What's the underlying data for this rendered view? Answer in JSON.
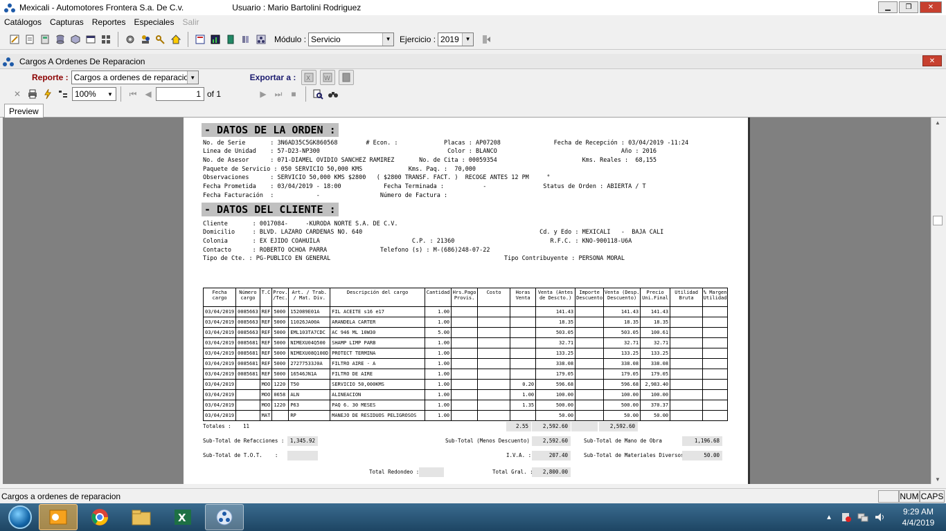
{
  "window": {
    "title": "Mexicali - Automotores Frontera S.a. De  C.v.",
    "user": "Usuario : Mario Bartolini Rodriguez"
  },
  "menu": [
    "Catálogos",
    "Capturas",
    "Reportes",
    "Especiales"
  ],
  "menu_disabled": "Salir",
  "toolbar": {
    "modulo_label": "Módulo :",
    "modulo_value": "Servicio",
    "ejercicio_label": "Ejercicio :",
    "ejercicio_value": "2019"
  },
  "child": {
    "title": "Cargos A Ordenes De Reparacion"
  },
  "report": {
    "label": "Reporte :",
    "value": "Cargos a ordenes de reparacion",
    "export_label": "Exportar a :"
  },
  "viewer": {
    "zoom": "100%",
    "page": "1",
    "of": "of 1",
    "tab": "Preview"
  },
  "doc": {
    "sec1": "- DATOS DE LA ORDEN :",
    "orden": [
      "No. de Serie       : 3N6AD35C5GK860568        # Econ. :             Placas : AP07208               Fecha de Recepción : 03/04/2019 -11:24",
      "Linea de Unidad    : 57-D23-NP300                                    Color : BLANCO                                   Año : 2016",
      "No. de Asesor      : 071-DIAMEL OVIDIO SANCHEZ RAMIREZ       No. de Cita : 00059354                        Kms. Reales :  68,155",
      "Paquete de Servicio : 050 SERVICIO 50,000 KMS             Kms. Paq. :  70,000",
      "Observaciones      : SERVICIO 50,000 KMS $2800   ( $2800 TRANSF. FACT. )  RECOGE ANTES 12 PM     °",
      "Fecha Prometida    : 03/04/2019 - 18:00            Fecha Terminada :           -                Status de Orden : ABIERTA / T",
      "Fecha Facturación  :            -                 Número de Factura :"
    ],
    "sec2": "- DATOS DEL CLIENTE :",
    "cliente": [
      "Cliente       : 0017084-     -KURODA NORTE S.A. DE C.V.",
      "Domicilio     : BLVD. LAZARO CARDENAS NO. 640                                                  Cd. y Edo : MEXICALI   -  BAJA CALI",
      "Colonia       : EX EJIDO COAHUILA                          C.P. : 21360                           R.F.C. : KNO-900118-U6A",
      "Contacto      : ROBERTO OCHOA PARRA               Telefono (s) : M-(686)248-07-22",
      "Tipo de Cte. : PG-PUBLICO EN GENERAL                                                 Tipo Contribuyente : PERSONA MORAL"
    ],
    "columns": [
      "Fecha cargo",
      "Número cargo",
      "T.C",
      "Prov. /Tec.",
      "Art. / Trab. / Mat. Div.",
      "Descripción del cargo",
      "Cantidad",
      "Hrs.Pago Provis.",
      "Costo",
      "Horas Venta",
      "Venta (Antes de Descto.)",
      "Importe Descuento",
      "Venta (Desp. Descuento)",
      "Precio Uni.Final",
      "Utilidad Bruta",
      "% Margen Utilidad"
    ],
    "rows": [
      [
        "03/04/2019",
        "0085663",
        "REF",
        "5000",
        "152089E01A",
        "FIL  ACEITE s16 e17",
        "1.00",
        "",
        "",
        "",
        "141.43",
        "",
        "141.43",
        "141.43",
        "",
        ""
      ],
      [
        "03/04/2019",
        "0085663",
        "REF",
        "5000",
        "11026JA00A",
        "ARANDELA CARTER",
        "1.00",
        "",
        "",
        "",
        "18.35",
        "",
        "18.35",
        "18.35",
        "",
        ""
      ],
      [
        "03/04/2019",
        "0085663",
        "REF",
        "5000",
        "EML103TA7CDC",
        "AC 946 ML 10W30",
        "5.00",
        "",
        "",
        "",
        "503.05",
        "",
        "503.05",
        "100.61",
        "",
        ""
      ],
      [
        "03/04/2019",
        "0085681",
        "REF",
        "5000",
        "NIMEXU04Q500",
        "SHAMP LIMP PARB",
        "1.00",
        "",
        "",
        "",
        "32.71",
        "",
        "32.71",
        "32.71",
        "",
        ""
      ],
      [
        "03/04/2019",
        "0085681",
        "REF",
        "5000",
        "NIMEXU08Q100D",
        "PROTECT TERMINA",
        "1.00",
        "",
        "",
        "",
        "133.25",
        "",
        "133.25",
        "133.25",
        "",
        ""
      ],
      [
        "03/04/2019",
        "0085681",
        "REF",
        "5000",
        "27277533J0A",
        "FILTRO AIRE - A",
        "1.00",
        "",
        "",
        "",
        "338.08",
        "",
        "338.08",
        "338.08",
        "",
        ""
      ],
      [
        "03/04/2019",
        "0085681",
        "REF",
        "5000",
        "16546JN1A",
        "FILTRO DE AIRE",
        "1.00",
        "",
        "",
        "",
        "179.05",
        "",
        "179.05",
        "179.05",
        "",
        ""
      ],
      [
        "03/04/2019",
        "",
        "MOO",
        "1220",
        "T50",
        "SERVICIO 50,000KMS",
        "1.00",
        "",
        "",
        "0.20",
        "596.68",
        "",
        "596.68",
        "2,983.40",
        "",
        ""
      ],
      [
        "03/04/2019",
        "",
        "MOO",
        "0658",
        "ALN",
        "ALINEACION",
        "1.00",
        "",
        "",
        "1.00",
        "100.00",
        "",
        "100.00",
        "100.00",
        "",
        ""
      ],
      [
        "03/04/2019",
        "",
        "MOO",
        "1220",
        "P63",
        "PAQ 6. 30 MESES",
        "1.00",
        "",
        "",
        "1.35",
        "500.00",
        "",
        "500.00",
        "370.37",
        "",
        ""
      ],
      [
        "03/04/2019",
        "",
        "MAT",
        "",
        "RP",
        "MANEJO DE RESIDUOS PELIGROSOS",
        "1.00",
        "",
        "",
        "",
        "50.00",
        "",
        "50.00",
        "50.00",
        "",
        ""
      ]
    ],
    "totales_label": "Totales :",
    "totales_count": "11",
    "tot_horas": "2.55",
    "tot_venta": "2,592.60",
    "tot_desp": "2,592.60",
    "sub_ref_label": "Sub-Total de Refacciones :",
    "sub_ref": "1,345.92",
    "sub_menos_label": "Sub-Total (Menos Descuento)",
    "sub_menos": "2,592.60",
    "sub_mo_label": "Sub-Total de Mano de Obra",
    "sub_mo": "1,196.68",
    "sub_tot_label": "Sub-Total de T.O.T.    :",
    "iva_label": "I.V.A. :",
    "iva": "207.40",
    "sub_mat_label": "Sub-Total de Materiales Diversos",
    "sub_mat": "50.00",
    "redondeo_label": "Total Redondeo :",
    "total_label": "Total Gral. :",
    "total": "2,800.00"
  },
  "status": {
    "text": "Cargos a ordenes de reparacion",
    "num": "NUM",
    "caps": "CAPS"
  },
  "clock": {
    "time": "9:29 AM",
    "date": "4/4/2019"
  }
}
